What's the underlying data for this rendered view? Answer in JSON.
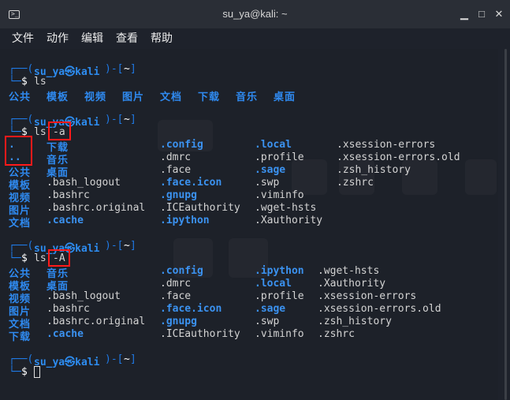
{
  "window": {
    "title": "su_ya@kali: ~"
  },
  "menu": [
    "文件",
    "动作",
    "编辑",
    "查看",
    "帮助"
  ],
  "prompt": {
    "top": "┌──(",
    "user": "su_ya㉿kali",
    "mid": ")-[",
    "dir": "~",
    "end": "]",
    "bottom": "└─",
    "sym": "$"
  },
  "cmd1": "ls",
  "out1": [
    "公共",
    "模板",
    "视频",
    "图片",
    "文档",
    "下载",
    "音乐",
    "桌面"
  ],
  "cmd2": "ls",
  "cmd2_flag": "-a",
  "out2": {
    "col1": [
      ".",
      "..",
      "公共",
      "视频",
      "图片",
      "文档"
    ],
    "col2": [
      "下载",
      "音乐",
      "桌面",
      ".bash_logout",
      ".bashrc",
      ".bashrc.original",
      ".cache"
    ],
    "col3": [
      ".config",
      ".dmrc",
      ".face",
      ".face.icon",
      ".gnupg",
      ".ICEauthority",
      ".ipython"
    ],
    "col4": [
      ".local",
      ".profile",
      ".sage",
      ".swp",
      ".viminfo",
      ".wget-hsts",
      ".Xauthority"
    ],
    "col5": [
      ".xsession-errors",
      ".xsession-errors.old",
      ".zsh_history",
      ".zshrc"
    ],
    "extra_model": "模板"
  },
  "cmd3": "ls",
  "cmd3_flag": "-A",
  "out3": {
    "col1": [
      "公共",
      "模板",
      "视频",
      "图片",
      "文档",
      "下载"
    ],
    "col2": [
      "音乐",
      "桌面",
      ".bash_logout",
      ".bashrc",
      ".bashrc.original",
      ".cache"
    ],
    "col3": [
      ".config",
      ".dmrc",
      ".face",
      ".face.icon",
      ".gnupg",
      ".ICEauthority"
    ],
    "col4": [
      ".ipython",
      ".local",
      ".profile",
      ".sage",
      ".swp",
      ".viminfo"
    ],
    "col5": [
      ".wget-hsts",
      ".Xauthority",
      ".xsession-errors",
      ".xsession-errors.old",
      ".zsh_history",
      ".zshrc"
    ]
  }
}
